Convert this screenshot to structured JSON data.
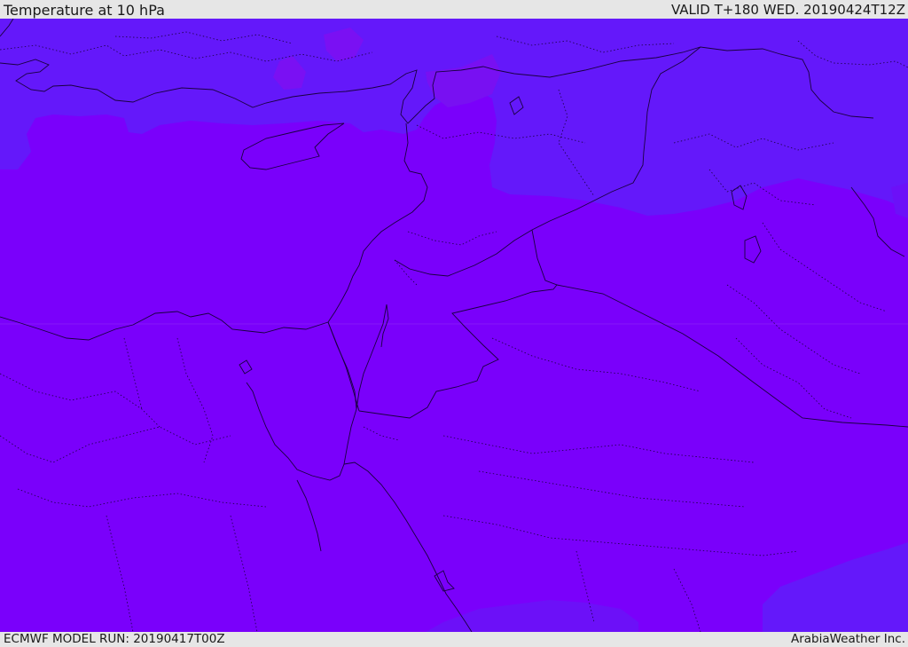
{
  "header": {
    "title": "Temperature at 10 hPa",
    "valid": "VALID T+180 WED. 20190424T12Z"
  },
  "footer": {
    "model_run": "ECMWF MODEL RUN: 20190417T00Z",
    "credit": "ArabiaWeather Inc."
  },
  "map": {
    "colors": {
      "base_field": "#7a00fb",
      "cooler_field": "#6418fa",
      "transition_field": "#7d08f6",
      "land_border": "#1a0040"
    }
  }
}
